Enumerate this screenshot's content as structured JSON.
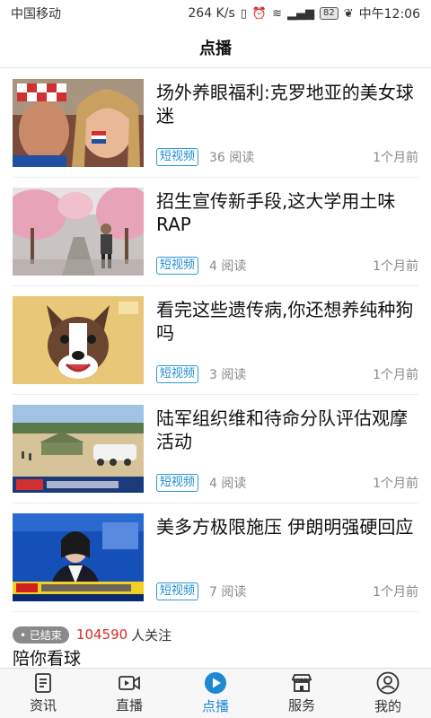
{
  "status_bar": {
    "carrier": "中国移动",
    "speed": "264 K/s",
    "battery": "82",
    "time": "中午12:06"
  },
  "header": {
    "title": "点播"
  },
  "news": [
    {
      "title": "场外养眼福利:克罗地亚的美女球迷",
      "tag": "短视频",
      "reads": "36 阅读",
      "time": "1个月前"
    },
    {
      "title": "招生宣传新手段,这大学用土味RAP",
      "tag": "短视频",
      "reads": "4 阅读",
      "time": "1个月前"
    },
    {
      "title": "看完这些遗传病,你还想养纯种狗吗",
      "tag": "短视频",
      "reads": "3 阅读",
      "time": "1个月前"
    },
    {
      "title": "陆军组织维和待命分队评估观摩活动",
      "tag": "短视频",
      "reads": "4 阅读",
      "time": "1个月前"
    },
    {
      "title": "美多方极限施压 伊朗明强硬回应",
      "tag": "短视频",
      "reads": "7 阅读",
      "time": "1个月前"
    }
  ],
  "live": {
    "badge": "• 已结束",
    "count": "104590",
    "label": "人关注",
    "title": "陪你看球"
  },
  "nav": [
    {
      "label": "资讯",
      "icon": "news-icon"
    },
    {
      "label": "直播",
      "icon": "video-camera-icon"
    },
    {
      "label": "点播",
      "icon": "play-icon"
    },
    {
      "label": "服务",
      "icon": "shop-icon"
    },
    {
      "label": "我的",
      "icon": "user-icon"
    }
  ],
  "colors": {
    "accent": "#1e88d4",
    "tag_border": "#2a9ad6",
    "count_red": "#d62b2b"
  }
}
